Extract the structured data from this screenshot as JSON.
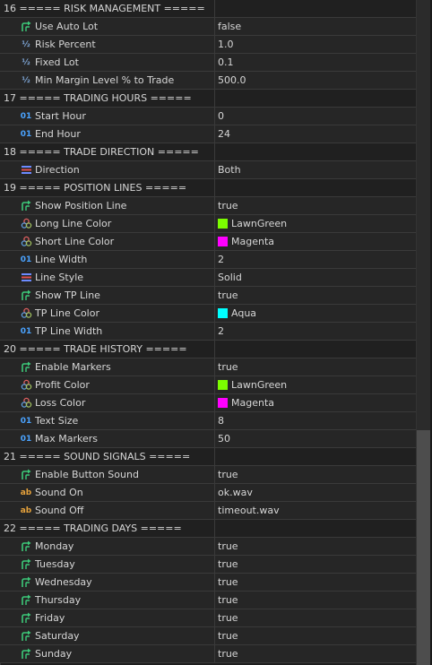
{
  "colors": {
    "LawnGreen": "#7cfc00",
    "Magenta": "#ff00ff",
    "Aqua": "#00ffff",
    "bool_icon": "#3cc879",
    "enum_icon": "#6c8bff",
    "color_icon": "#c56b6b",
    "int_icon": "#4aa3ff",
    "double_icon": "#7fa7d8",
    "string_icon": "#e6a23c"
  },
  "rows": [
    {
      "type": "header",
      "label": "16 ===== RISK MANAGEMENT ====="
    },
    {
      "type": "param",
      "icon": "bool",
      "label": "Use Auto Lot",
      "value": "false"
    },
    {
      "type": "param",
      "icon": "double",
      "label": "Risk Percent",
      "value": "1.0"
    },
    {
      "type": "param",
      "icon": "double",
      "label": "Fixed Lot",
      "value": "0.1"
    },
    {
      "type": "param",
      "icon": "double",
      "label": "Min Margin Level % to Trade",
      "value": "500.0"
    },
    {
      "type": "header",
      "label": "17 ===== TRADING HOURS ====="
    },
    {
      "type": "param",
      "icon": "int",
      "label": "Start Hour",
      "value": "0"
    },
    {
      "type": "param",
      "icon": "int",
      "label": "End Hour",
      "value": "24"
    },
    {
      "type": "header",
      "label": "18 ===== TRADE DIRECTION ====="
    },
    {
      "type": "param",
      "icon": "enum",
      "label": "Direction",
      "value": "Both"
    },
    {
      "type": "header",
      "label": "19 ===== POSITION LINES ====="
    },
    {
      "type": "param",
      "icon": "bool",
      "label": "Show Position Line",
      "value": "true"
    },
    {
      "type": "param",
      "icon": "color",
      "label": "Long Line Color",
      "value": "LawnGreen",
      "swatch": "LawnGreen"
    },
    {
      "type": "param",
      "icon": "color",
      "label": "Short Line Color",
      "value": "Magenta",
      "swatch": "Magenta"
    },
    {
      "type": "param",
      "icon": "int",
      "label": "Line Width",
      "value": "2"
    },
    {
      "type": "param",
      "icon": "enum",
      "label": "Line Style",
      "value": "Solid"
    },
    {
      "type": "param",
      "icon": "bool",
      "label": "Show TP Line",
      "value": "true"
    },
    {
      "type": "param",
      "icon": "color",
      "label": "TP Line Color",
      "value": "Aqua",
      "swatch": "Aqua"
    },
    {
      "type": "param",
      "icon": "int",
      "label": "TP Line Width",
      "value": "2"
    },
    {
      "type": "header",
      "label": "20 ===== TRADE HISTORY ====="
    },
    {
      "type": "param",
      "icon": "bool",
      "label": "Enable Markers",
      "value": "true"
    },
    {
      "type": "param",
      "icon": "color",
      "label": "Profit Color",
      "value": "LawnGreen",
      "swatch": "LawnGreen"
    },
    {
      "type": "param",
      "icon": "color",
      "label": "Loss Color",
      "value": "Magenta",
      "swatch": "Magenta"
    },
    {
      "type": "param",
      "icon": "int",
      "label": "Text Size",
      "value": "8"
    },
    {
      "type": "param",
      "icon": "int",
      "label": "Max Markers",
      "value": "50"
    },
    {
      "type": "header",
      "label": "21 ===== SOUND SIGNALS ====="
    },
    {
      "type": "param",
      "icon": "bool",
      "label": "Enable Button Sound",
      "value": "true"
    },
    {
      "type": "param",
      "icon": "string",
      "label": "Sound On",
      "value": "ok.wav"
    },
    {
      "type": "param",
      "icon": "string",
      "label": "Sound Off",
      "value": "timeout.wav"
    },
    {
      "type": "header",
      "label": "22 ===== TRADING DAYS ====="
    },
    {
      "type": "param",
      "icon": "bool",
      "label": "Monday",
      "value": "true"
    },
    {
      "type": "param",
      "icon": "bool",
      "label": "Tuesday",
      "value": "true"
    },
    {
      "type": "param",
      "icon": "bool",
      "label": "Wednesday",
      "value": "true"
    },
    {
      "type": "param",
      "icon": "bool",
      "label": "Thursday",
      "value": "true"
    },
    {
      "type": "param",
      "icon": "bool",
      "label": "Friday",
      "value": "true"
    },
    {
      "type": "param",
      "icon": "bool",
      "label": "Saturday",
      "value": "true"
    },
    {
      "type": "param",
      "icon": "bool",
      "label": "Sunday",
      "value": "true"
    }
  ]
}
